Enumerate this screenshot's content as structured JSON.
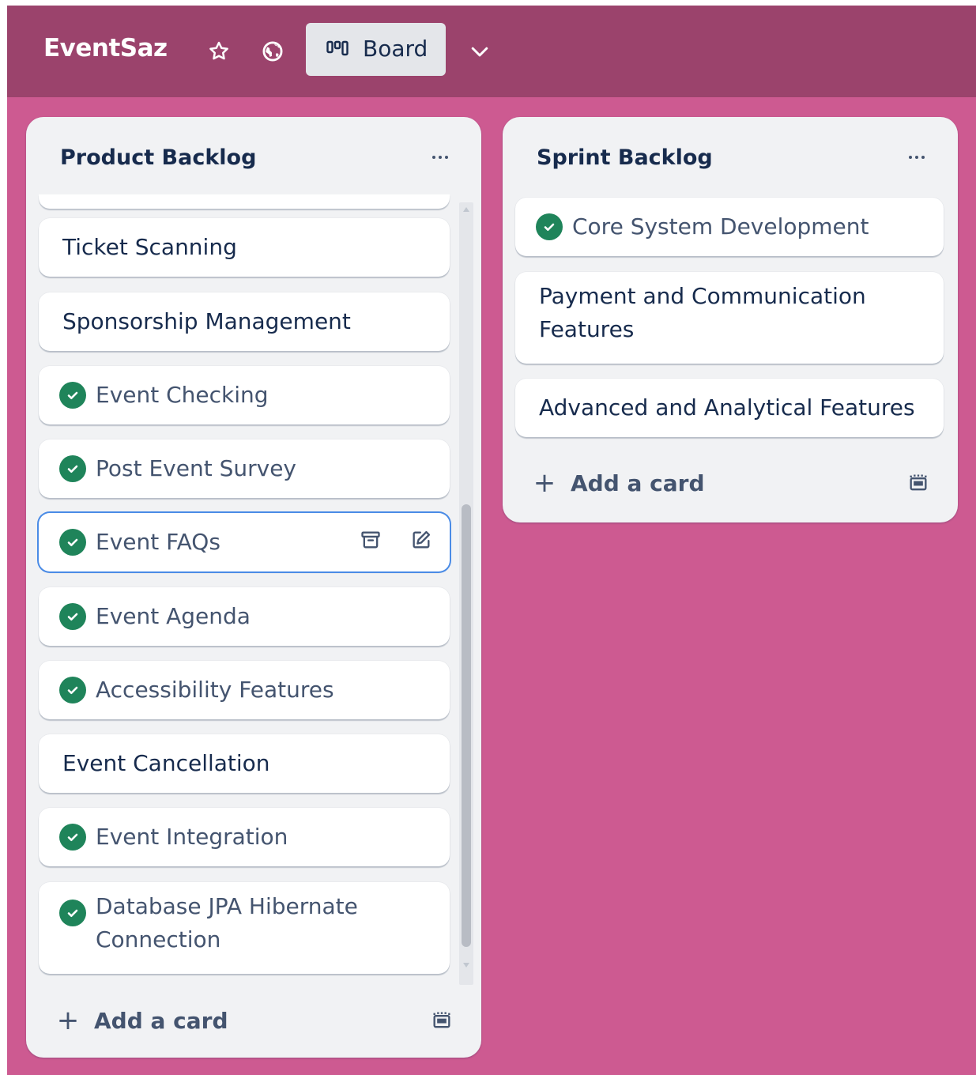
{
  "header": {
    "board_name": "EventSaz",
    "view_label": "Board",
    "star_icon": "star-icon",
    "visibility_icon": "globe-icon",
    "view_icon": "board-icon",
    "dropdown_icon": "chevron-down-icon"
  },
  "colors": {
    "background": "#cd5a91",
    "header": "#9b436c",
    "check_green": "#1f845a",
    "focus_border": "#4a8be6"
  },
  "lists": [
    {
      "title": "Product Backlog",
      "cards": [
        {
          "title": "Ticket Scanning",
          "done": false
        },
        {
          "title": "Sponsorship Management",
          "done": false
        },
        {
          "title": "Event Checking",
          "done": true
        },
        {
          "title": "Post Event Survey",
          "done": true
        },
        {
          "title": "Event FAQs",
          "done": true,
          "focused": true
        },
        {
          "title": "Event Agenda",
          "done": true
        },
        {
          "title": "Accessibility Features",
          "done": true
        },
        {
          "title": "Event Cancellation",
          "done": false
        },
        {
          "title": "Event Integration",
          "done": true
        },
        {
          "title": "Database JPA Hibernate Connection",
          "done": true
        }
      ],
      "add_card_label": "Add a card"
    },
    {
      "title": "Sprint Backlog",
      "cards": [
        {
          "title": "Core System Development",
          "done": true
        },
        {
          "title": "Payment and Communication Features",
          "done": false
        },
        {
          "title": "Advanced and Analytical Features",
          "done": false
        }
      ],
      "add_card_label": "Add a card"
    }
  ]
}
